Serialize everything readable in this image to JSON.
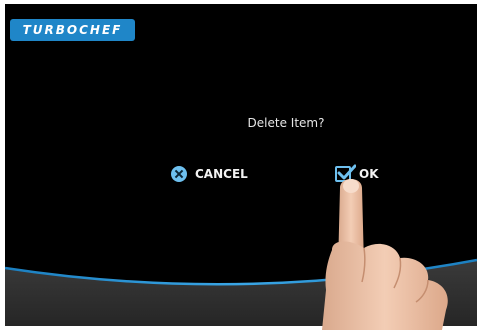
{
  "header": {
    "logo_text": "TURBOCHEF"
  },
  "dialog": {
    "message": "Delete Item?",
    "cancel_label": "CANCEL",
    "ok_label": "OK"
  },
  "icons": {
    "cancel": "close-circle-icon",
    "ok": "checkbox-checked-icon"
  },
  "colors": {
    "background": "#000000",
    "accent": "#6ec0ef",
    "logo": "#1f86c8"
  }
}
